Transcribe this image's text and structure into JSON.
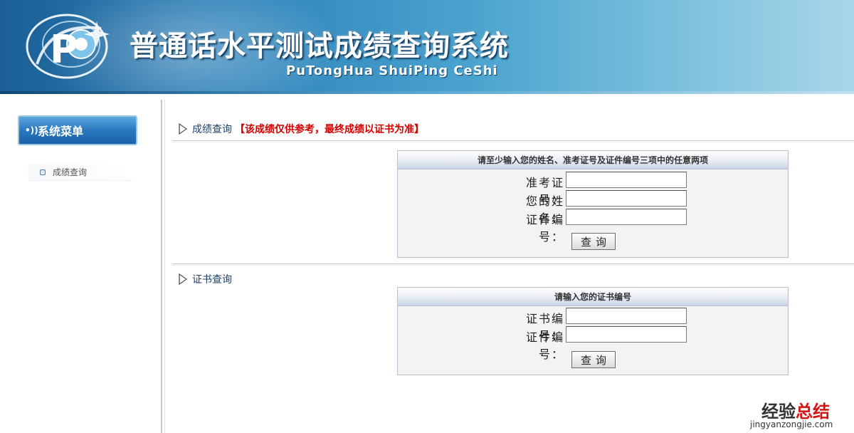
{
  "header": {
    "title_cn": "普通话水平测试成绩查询系统",
    "title_en": "PuTongHua ShuiPing CeShi",
    "logo_letter": "P"
  },
  "sidebar": {
    "menu_title": "系统菜单",
    "items": [
      {
        "label": "成绩查询",
        "icon": "bullet-square-icon"
      }
    ]
  },
  "score_section": {
    "title": "成绩查询",
    "notice": "【该成绩仅供参考，最终成绩以证书为准】",
    "panel_title": "请至少输入您的姓名、准考证号及证件编号三项中的任意两项",
    "fields": [
      {
        "label": "准考证号：",
        "value": ""
      },
      {
        "label": "您的姓名：",
        "value": ""
      },
      {
        "label": "证件编号：",
        "value": ""
      }
    ],
    "button": "查询"
  },
  "cert_section": {
    "title": "证书查询",
    "panel_title": "请输入您的证书编号",
    "fields": [
      {
        "label": "证书编号：",
        "value": ""
      },
      {
        "label": "证件编号：",
        "value": ""
      }
    ],
    "button": "查询"
  },
  "watermark": {
    "cn_part1": "经验",
    "cn_part2": "总结",
    "en": "jingyanzongjie.com"
  },
  "colors": {
    "header_dark": "#1c5f96",
    "header_light": "#a9d6e8",
    "notice_red": "#d40000",
    "section_text": "#1f3f66"
  }
}
